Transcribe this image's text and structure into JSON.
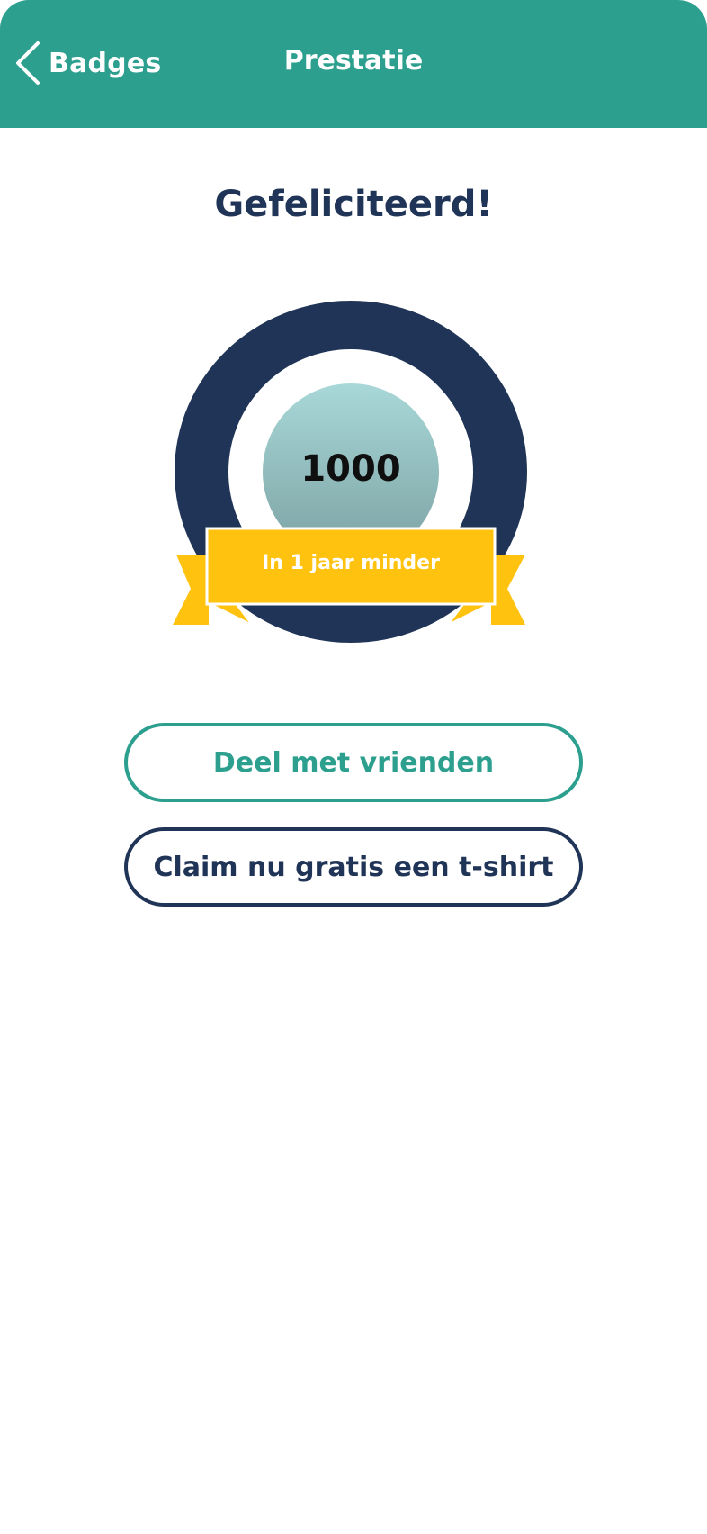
{
  "header": {
    "back_label": "Badges",
    "title": "Prestatie",
    "back_icon": "chevron-left-icon"
  },
  "main": {
    "heading": "Gefeliciteerd!",
    "badge": {
      "number": "1000",
      "ribbon_text": "In 1 jaar minder"
    },
    "buttons": {
      "share_label": "Deel met vrienden",
      "claim_label": "Claim nu gratis een t-shirt"
    }
  },
  "colors": {
    "header_bg": "#2c9f8e",
    "navy": "#1f3456",
    "ribbon": "#ffc20e",
    "badge_center_top": "#a9d8d8",
    "badge_center_bottom": "#7ba0a2"
  }
}
